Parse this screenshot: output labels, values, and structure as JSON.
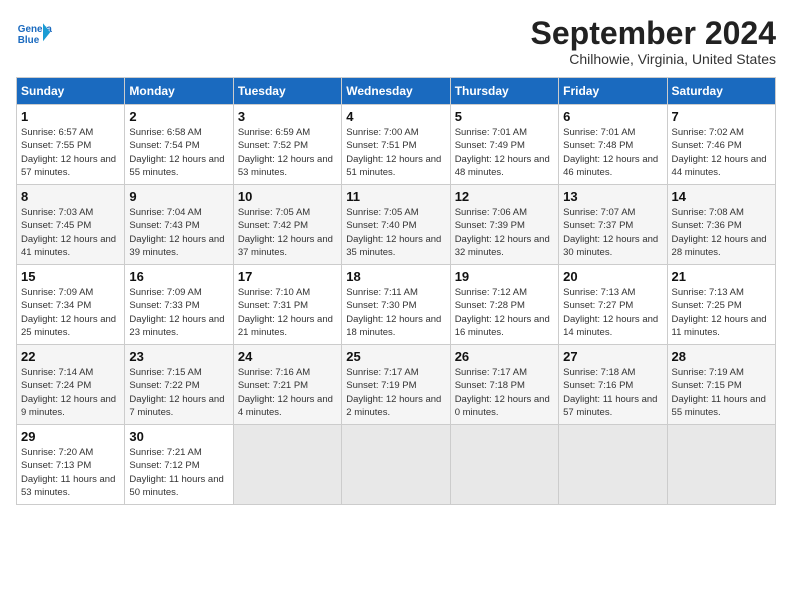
{
  "logo": {
    "line1": "General",
    "line2": "Blue"
  },
  "title": "September 2024",
  "location": "Chilhowie, Virginia, United States",
  "days_of_week": [
    "Sunday",
    "Monday",
    "Tuesday",
    "Wednesday",
    "Thursday",
    "Friday",
    "Saturday"
  ],
  "weeks": [
    [
      {
        "num": "1",
        "rise": "6:57 AM",
        "set": "7:55 PM",
        "daylight": "12 hours and 57 minutes."
      },
      {
        "num": "2",
        "rise": "6:58 AM",
        "set": "7:54 PM",
        "daylight": "12 hours and 55 minutes."
      },
      {
        "num": "3",
        "rise": "6:59 AM",
        "set": "7:52 PM",
        "daylight": "12 hours and 53 minutes."
      },
      {
        "num": "4",
        "rise": "7:00 AM",
        "set": "7:51 PM",
        "daylight": "12 hours and 51 minutes."
      },
      {
        "num": "5",
        "rise": "7:01 AM",
        "set": "7:49 PM",
        "daylight": "12 hours and 48 minutes."
      },
      {
        "num": "6",
        "rise": "7:01 AM",
        "set": "7:48 PM",
        "daylight": "12 hours and 46 minutes."
      },
      {
        "num": "7",
        "rise": "7:02 AM",
        "set": "7:46 PM",
        "daylight": "12 hours and 44 minutes."
      }
    ],
    [
      {
        "num": "8",
        "rise": "7:03 AM",
        "set": "7:45 PM",
        "daylight": "12 hours and 41 minutes."
      },
      {
        "num": "9",
        "rise": "7:04 AM",
        "set": "7:43 PM",
        "daylight": "12 hours and 39 minutes."
      },
      {
        "num": "10",
        "rise": "7:05 AM",
        "set": "7:42 PM",
        "daylight": "12 hours and 37 minutes."
      },
      {
        "num": "11",
        "rise": "7:05 AM",
        "set": "7:40 PM",
        "daylight": "12 hours and 35 minutes."
      },
      {
        "num": "12",
        "rise": "7:06 AM",
        "set": "7:39 PM",
        "daylight": "12 hours and 32 minutes."
      },
      {
        "num": "13",
        "rise": "7:07 AM",
        "set": "7:37 PM",
        "daylight": "12 hours and 30 minutes."
      },
      {
        "num": "14",
        "rise": "7:08 AM",
        "set": "7:36 PM",
        "daylight": "12 hours and 28 minutes."
      }
    ],
    [
      {
        "num": "15",
        "rise": "7:09 AM",
        "set": "7:34 PM",
        "daylight": "12 hours and 25 minutes."
      },
      {
        "num": "16",
        "rise": "7:09 AM",
        "set": "7:33 PM",
        "daylight": "12 hours and 23 minutes."
      },
      {
        "num": "17",
        "rise": "7:10 AM",
        "set": "7:31 PM",
        "daylight": "12 hours and 21 minutes."
      },
      {
        "num": "18",
        "rise": "7:11 AM",
        "set": "7:30 PM",
        "daylight": "12 hours and 18 minutes."
      },
      {
        "num": "19",
        "rise": "7:12 AM",
        "set": "7:28 PM",
        "daylight": "12 hours and 16 minutes."
      },
      {
        "num": "20",
        "rise": "7:13 AM",
        "set": "7:27 PM",
        "daylight": "12 hours and 14 minutes."
      },
      {
        "num": "21",
        "rise": "7:13 AM",
        "set": "7:25 PM",
        "daylight": "12 hours and 11 minutes."
      }
    ],
    [
      {
        "num": "22",
        "rise": "7:14 AM",
        "set": "7:24 PM",
        "daylight": "12 hours and 9 minutes."
      },
      {
        "num": "23",
        "rise": "7:15 AM",
        "set": "7:22 PM",
        "daylight": "12 hours and 7 minutes."
      },
      {
        "num": "24",
        "rise": "7:16 AM",
        "set": "7:21 PM",
        "daylight": "12 hours and 4 minutes."
      },
      {
        "num": "25",
        "rise": "7:17 AM",
        "set": "7:19 PM",
        "daylight": "12 hours and 2 minutes."
      },
      {
        "num": "26",
        "rise": "7:17 AM",
        "set": "7:18 PM",
        "daylight": "12 hours and 0 minutes."
      },
      {
        "num": "27",
        "rise": "7:18 AM",
        "set": "7:16 PM",
        "daylight": "11 hours and 57 minutes."
      },
      {
        "num": "28",
        "rise": "7:19 AM",
        "set": "7:15 PM",
        "daylight": "11 hours and 55 minutes."
      }
    ],
    [
      {
        "num": "29",
        "rise": "7:20 AM",
        "set": "7:13 PM",
        "daylight": "11 hours and 53 minutes."
      },
      {
        "num": "30",
        "rise": "7:21 AM",
        "set": "7:12 PM",
        "daylight": "11 hours and 50 minutes."
      },
      null,
      null,
      null,
      null,
      null
    ]
  ]
}
